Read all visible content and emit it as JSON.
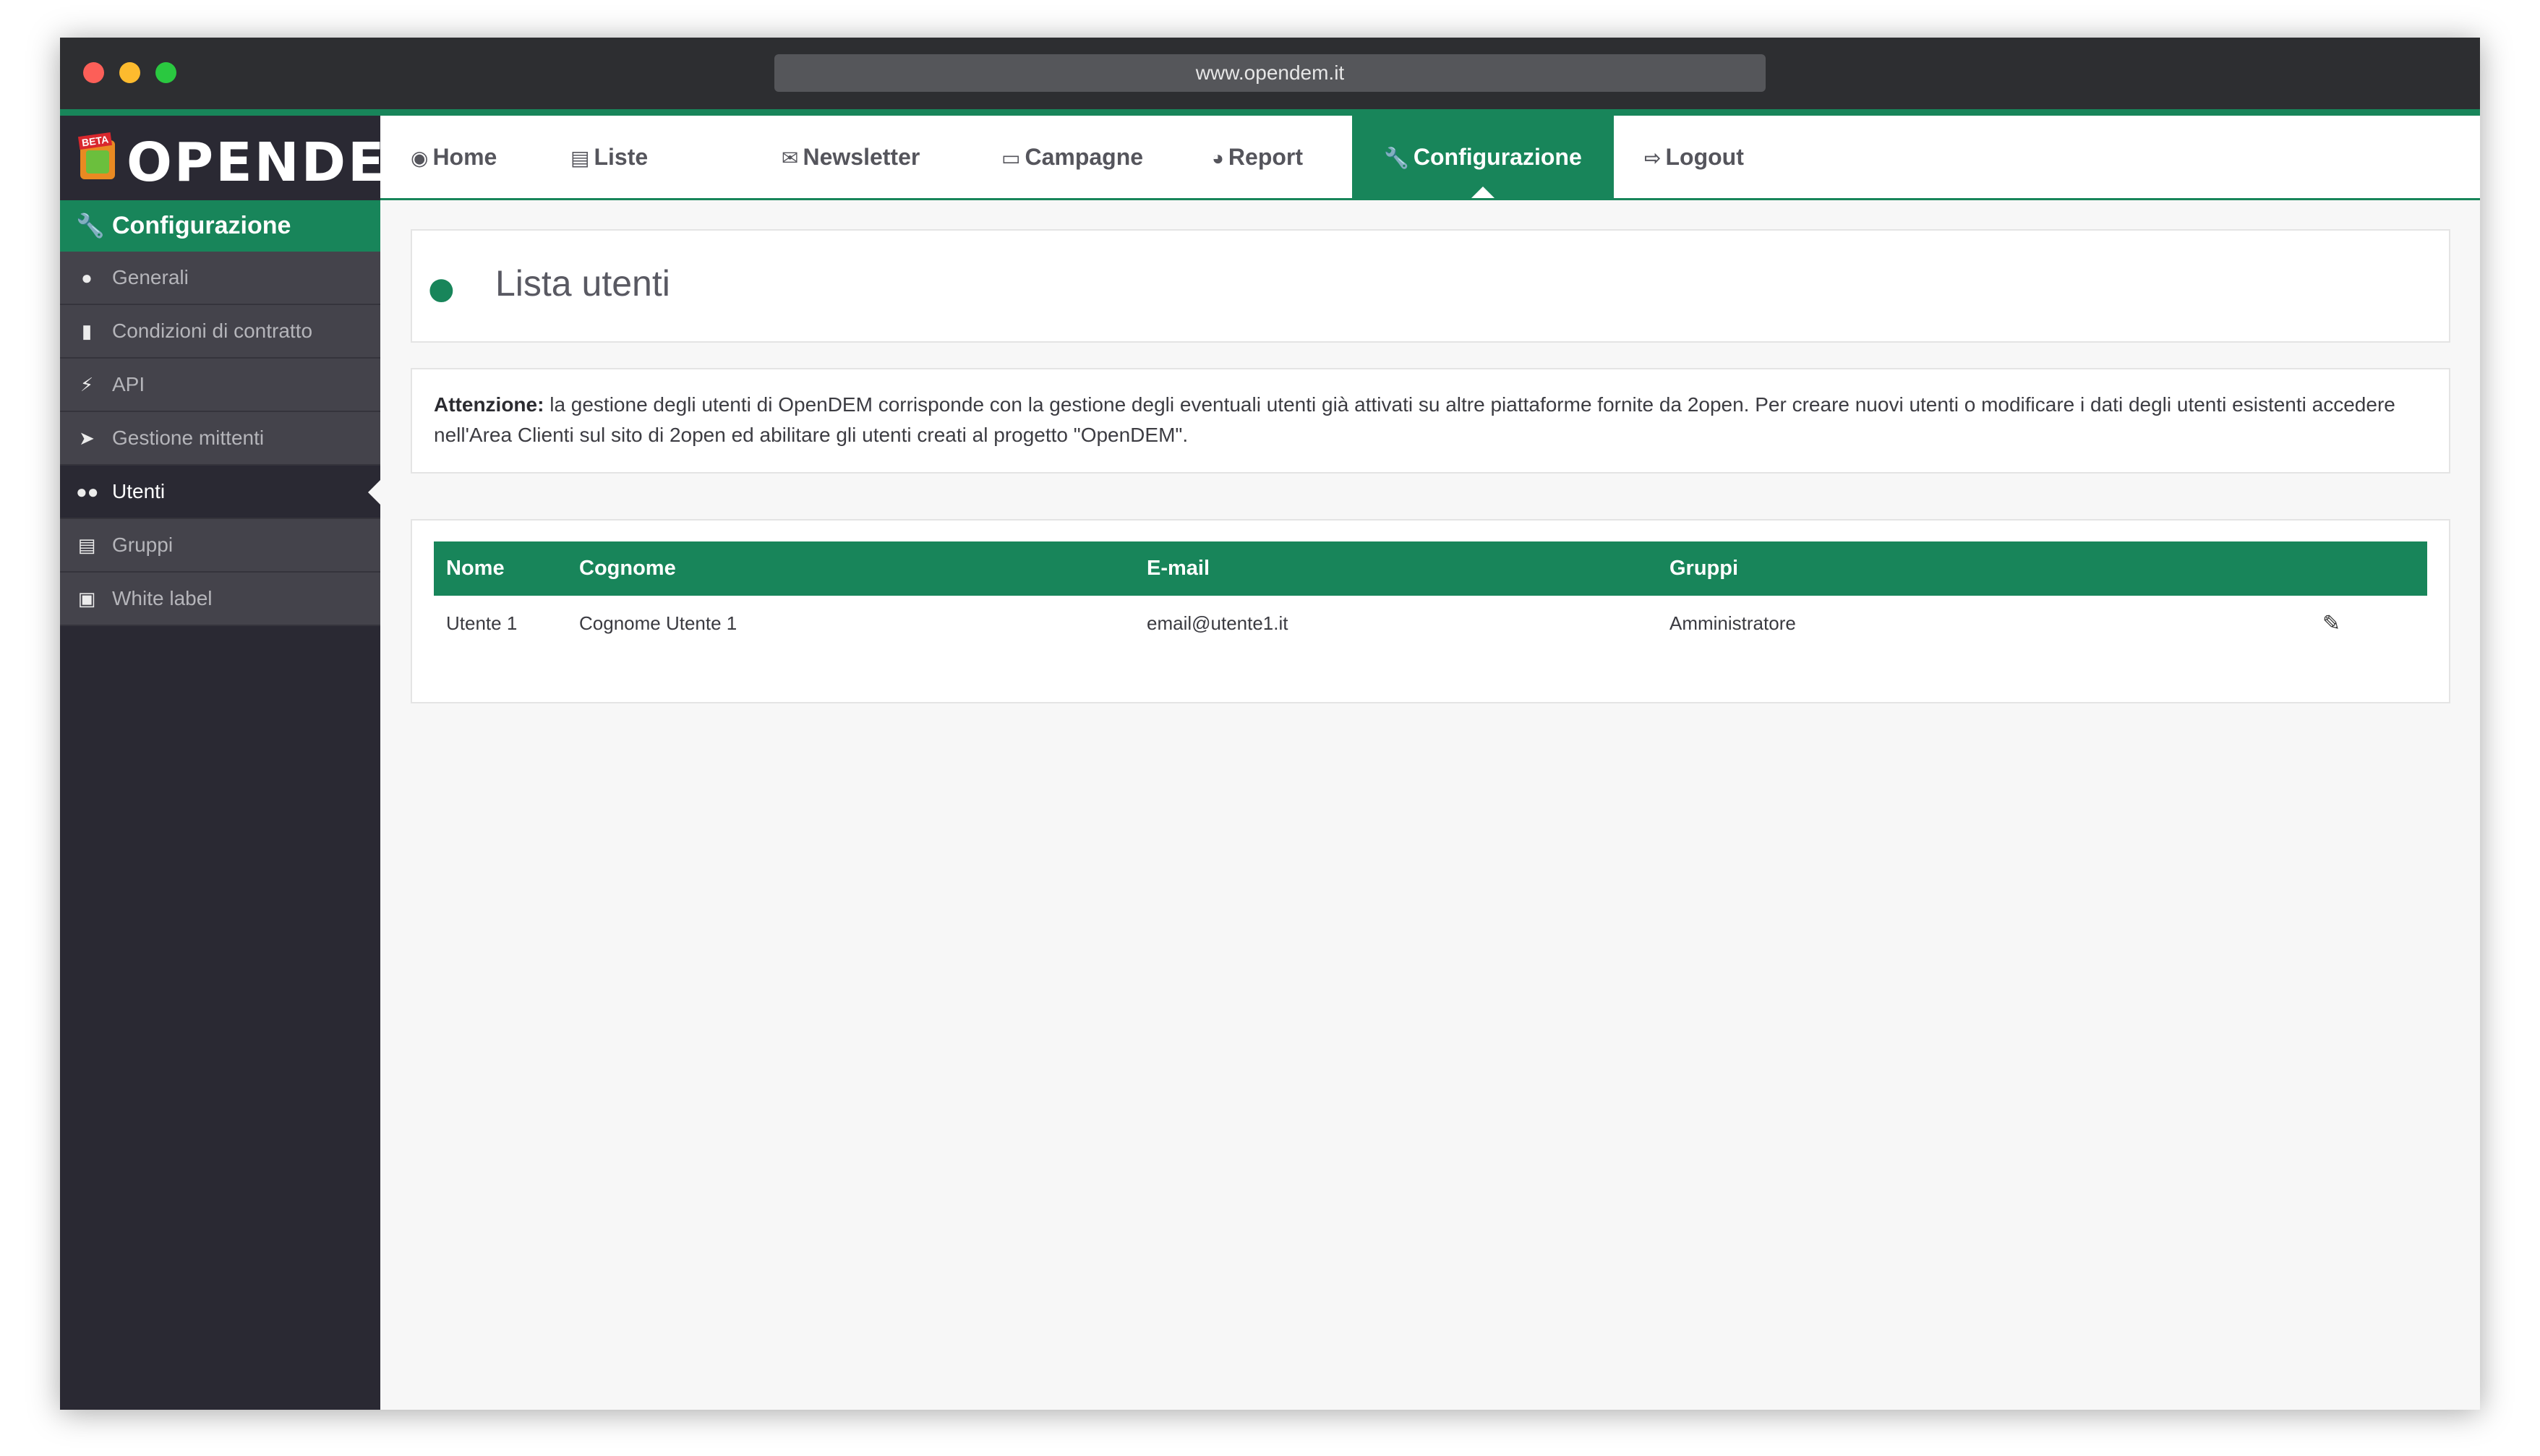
{
  "browser": {
    "url": "www.opendem.it"
  },
  "app": {
    "logo_badge": "BETA",
    "logo_text": "OPENDEM"
  },
  "topnav": {
    "items": [
      {
        "label": "Home",
        "icon": "dashboard-icon"
      },
      {
        "label": "Liste",
        "icon": "list-icon"
      },
      {
        "label": "Newsletter",
        "icon": "envelope-icon"
      },
      {
        "label": "Campagne",
        "icon": "folder-icon"
      },
      {
        "label": "Report",
        "icon": "pie-chart-icon"
      },
      {
        "label": "Configurazione",
        "icon": "wrench-icon",
        "active": true
      },
      {
        "label": "Logout",
        "icon": "logout-icon"
      }
    ]
  },
  "sidebar": {
    "header": {
      "label": "Configurazione",
      "icon": "wrench-icon"
    },
    "items": [
      {
        "label": "Generali",
        "icon": "globe-icon"
      },
      {
        "label": "Condizioni di contratto",
        "icon": "document-icon"
      },
      {
        "label": "API",
        "icon": "plug-icon"
      },
      {
        "label": "Gestione mittenti",
        "icon": "send-icon"
      },
      {
        "label": "Utenti",
        "icon": "users-icon",
        "active": true
      },
      {
        "label": "Gruppi",
        "icon": "id-card-icon"
      },
      {
        "label": "White label",
        "icon": "image-icon"
      }
    ]
  },
  "page": {
    "title": "Lista utenti",
    "notice_label": "Attenzione:",
    "notice_text": " la gestione degli utenti di OpenDEM corrisponde con la gestione degli eventuali utenti già attivati su altre piattaforme fornite da 2open. Per creare nuovi utenti o modificare i dati degli utenti esistenti accedere nell'Area Clienti sul sito di 2open ed abilitare gli utenti creati al progetto \"OpenDEM\"."
  },
  "users_table": {
    "columns": [
      "Nome",
      "Cognome",
      "E-mail",
      "Gruppi"
    ],
    "rows": [
      {
        "nome": "Utente 1",
        "cognome": "Cognome Utente 1",
        "email": "email@utente1.it",
        "gruppi": "Amministratore"
      }
    ]
  },
  "colors": {
    "accent": "#18855a",
    "sidebar": "#2a2933"
  }
}
